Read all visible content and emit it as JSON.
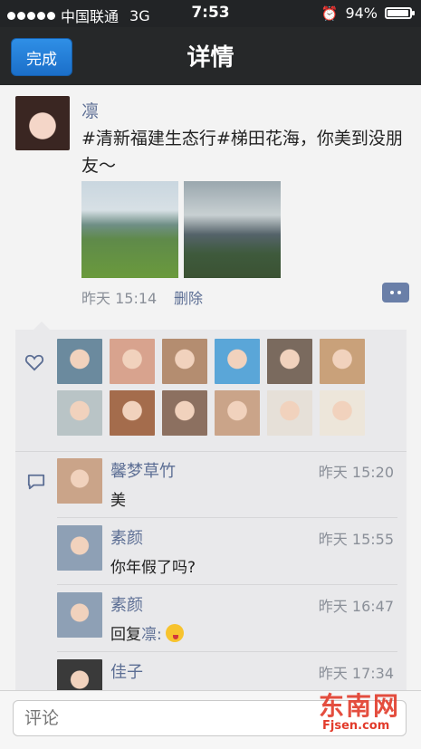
{
  "status_bar": {
    "carrier": "中国联通",
    "network": "3G",
    "time": "7:53",
    "battery": "94%",
    "battery_level": 0.94
  },
  "navbar": {
    "done_label": "完成",
    "title": "详情"
  },
  "post": {
    "author": "凛",
    "text": "#清新福建生态行#梯田花海，你美到没朋友～",
    "time": "昨天 15:14",
    "delete_label": "删除"
  },
  "likes_count": 12,
  "comments": [
    {
      "name": "馨梦草竹",
      "time": "昨天 15:20",
      "text": "美",
      "reply_to": "",
      "has_emoji": false
    },
    {
      "name": "素颜",
      "time": "昨天 15:55",
      "text": "你年假了吗?",
      "reply_to": "",
      "has_emoji": false
    },
    {
      "name": "素颜",
      "time": "昨天 16:47",
      "text": "回复",
      "reply_to": "凛:",
      "has_emoji": true
    },
    {
      "name": "佳子",
      "time": "昨天 17:34",
      "text": "",
      "reply_to": "",
      "has_emoji": false
    }
  ],
  "comment_input": {
    "placeholder": "评论"
  },
  "watermark": {
    "main": "东南网",
    "sub": "Fjsen.com"
  },
  "colors": {
    "nav_bg": "#262829",
    "link": "#5c6e94",
    "accent": "#1b6fc9",
    "watermark": "#e23b2b"
  }
}
